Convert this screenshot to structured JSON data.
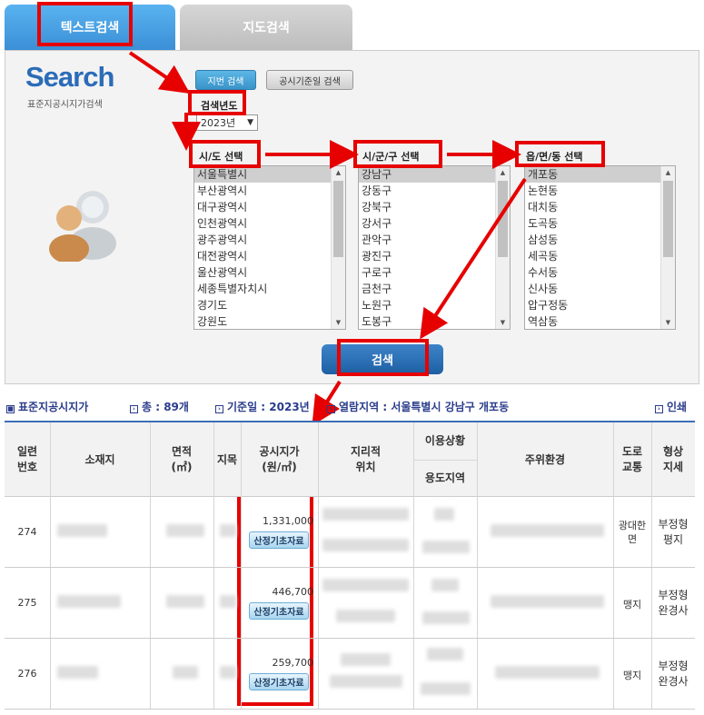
{
  "tabs": {
    "text_search": "텍스트검색",
    "map_search": "지도검색"
  },
  "logo": {
    "word": "Search",
    "subtitle": "표준지공시지가검색"
  },
  "search_buttons": {
    "lot_number": "지번 검색",
    "base_date": "공시기준일 검색"
  },
  "year": {
    "label": "검색년도",
    "value": "2023년"
  },
  "sido": {
    "label": "시/도 선택",
    "items": [
      "서울특별시",
      "부산광역시",
      "대구광역시",
      "인천광역시",
      "광주광역시",
      "대전광역시",
      "울산광역시",
      "세종특별자치시",
      "경기도",
      "강원도"
    ]
  },
  "sigungu": {
    "label": "시/군/구 선택",
    "items": [
      "강남구",
      "강동구",
      "강북구",
      "강서구",
      "관악구",
      "광진구",
      "구로구",
      "금천구",
      "노원구",
      "도봉구"
    ]
  },
  "dong": {
    "label": "읍/면/동 선택",
    "items": [
      "개포동",
      "논현동",
      "대치동",
      "도곡동",
      "삼성동",
      "세곡동",
      "수서동",
      "신사동",
      "압구정동",
      "역삼동"
    ]
  },
  "search_button": "검색",
  "info": {
    "title": "표준지공시지가",
    "total": "총 : 89개",
    "base_date": "기준일 : 2023년",
    "region": "열람지역 : 서울특별시 강남구 개포동",
    "print": "인쇄"
  },
  "table": {
    "headers": {
      "serial": [
        "일련",
        "번호"
      ],
      "location": "소재지",
      "area": [
        "면적",
        "(㎡)"
      ],
      "category": "지목",
      "price": [
        "공시지가",
        "(원/㎡)"
      ],
      "geo": [
        "지리적",
        "위치"
      ],
      "use_status": "이용상황",
      "use_zone": "용도지역",
      "surroundings": "주위환경",
      "road": [
        "도로",
        "교통"
      ],
      "shape": [
        "형상",
        "지세"
      ]
    },
    "calc_button": "산정기초자료",
    "rows": [
      {
        "serial": "274",
        "price": "1,331,000",
        "road": [
          "광대한",
          "면"
        ],
        "shape": [
          "부정형",
          "평지"
        ]
      },
      {
        "serial": "275",
        "price": "446,700",
        "road": [
          "맹지"
        ],
        "shape": [
          "부정형",
          "완경사"
        ]
      },
      {
        "serial": "276",
        "price": "259,700",
        "road": [
          "맹지"
        ],
        "shape": [
          "부정형",
          "완경사"
        ]
      }
    ]
  },
  "colors": {
    "accent": "#e60000",
    "tab_active": "#3b8fd6",
    "search_button": "#1e5fa3",
    "info_text": "#2a3c8c"
  }
}
